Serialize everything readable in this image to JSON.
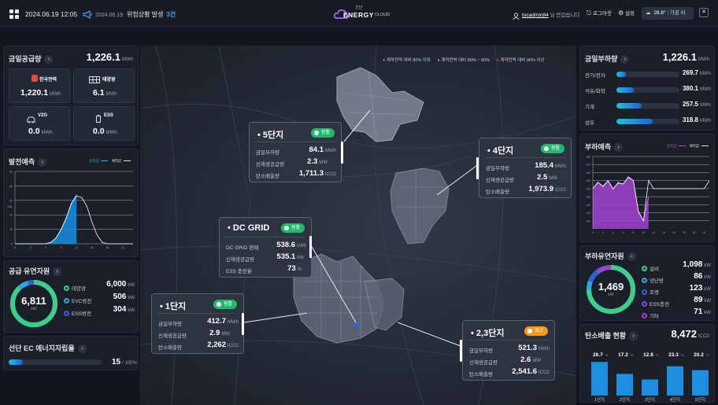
{
  "header": {
    "datetime": "2024.06.19 12:05",
    "alert_date": "2024.06.19",
    "alert_text": "위험상황 발생",
    "alert_count": "3건",
    "logo_top": "선단",
    "logo_main": "ENERGY",
    "logo_sub": "CLOUD",
    "user_name": "tocadmin84",
    "user_suffix": "님 반갑습니다",
    "logout": "로그아웃",
    "settings": "설정",
    "weather_temp": "28.8°",
    "weather_desc": "가끔 비",
    "close": "✕"
  },
  "supply": {
    "title": "금일공급량",
    "total": "1,226.1",
    "total_unit": "MWh",
    "cards": [
      {
        "label": "한국전력",
        "value": "1,220.1",
        "unit": "MWh",
        "icon": "utility-pole-icon"
      },
      {
        "label": "태양광",
        "value": "6.1",
        "unit": "MWh",
        "icon": "solar-panel-icon"
      },
      {
        "label": "V2G",
        "value": "0.0",
        "unit": "MWh",
        "icon": "ev-car-icon"
      },
      {
        "label": "ESS",
        "value": "0.0",
        "unit": "MWh",
        "icon": "battery-icon"
      }
    ]
  },
  "forecast": {
    "title": "발전예측",
    "legend_actual": "실측값",
    "legend_pred": "예측값",
    "chart_data": {
      "type": "area",
      "x": [
        0,
        1,
        2,
        3,
        4,
        5,
        6,
        7,
        8,
        9,
        10,
        11,
        12,
        13,
        14,
        15,
        16,
        17,
        18,
        19,
        20,
        21,
        22,
        23
      ],
      "series": [
        {
          "name": "실측값",
          "values": [
            0,
            0,
            0,
            0,
            0,
            0,
            0,
            1,
            4,
            10,
            18,
            28,
            34,
            null,
            null,
            null,
            null,
            null,
            null,
            null,
            null,
            null,
            null,
            null
          ]
        },
        {
          "name": "예측값",
          "values": [
            0,
            0,
            0,
            0,
            0,
            0,
            0,
            1,
            4,
            10,
            18,
            28,
            33,
            32,
            26,
            15,
            6,
            1,
            0,
            0,
            0,
            0,
            0,
            0
          ]
        }
      ],
      "ylim": [
        0,
        50
      ],
      "ytick_labels": [
        "0",
        "10",
        "20",
        "30",
        "40",
        "50"
      ],
      "xtick_labels": [
        "0",
        "3",
        "6",
        "9",
        "12",
        "15",
        "18",
        "21"
      ],
      "grid": true,
      "ylabel": "kW"
    }
  },
  "supply_resources": {
    "title": "공급 유연자원",
    "total": "6,811",
    "unit": "kW",
    "items": [
      {
        "label": "태양광",
        "value": "6,000",
        "unit": "kW",
        "color": "#3ad08a"
      },
      {
        "label": "EVC방전",
        "value": "506",
        "unit": "kW",
        "color": "#2aa9e0"
      },
      {
        "label": "ESS방전",
        "value": "304",
        "unit": "kW",
        "color": "#2f62d8"
      }
    ]
  },
  "self_rate": {
    "title": "선단 EC 에너지자립율",
    "value": "15",
    "unit": "/ 100%",
    "fraction": 0.15
  },
  "map": {
    "legend": [
      {
        "label": "계약전력 대비 80% 이하",
        "color": "#27c28a"
      },
      {
        "label": "계약전력 대비 80% ~ 90%",
        "color": "#f29a1a"
      },
      {
        "label": "계약전력 대비 90% 이상",
        "color": "#e0463c"
      }
    ],
    "label_row1": "금일부하량",
    "label_row2": "신재생공급량",
    "label_row3": "탄소배출량",
    "units": [
      "MWh",
      "MW",
      "tCO2"
    ],
    "sites": [
      {
        "name": "5단지",
        "status": "원활",
        "v1": "84.1",
        "v2": "2.3",
        "v3": "1,711.3"
      },
      {
        "name": "4단지",
        "status": "원활",
        "v1": "185.4",
        "v2": "2.5",
        "v3": "1,973.9"
      },
      {
        "name": "1단지",
        "status": "원활",
        "v1": "412.7",
        "v2": "2.9",
        "v3": "2,262"
      },
      {
        "name": "2,3단지",
        "status": "경고",
        "v1": "521.3",
        "v2": "2.6",
        "v3": "2,541.6"
      }
    ],
    "dcgrid": {
      "name": "DC GRID",
      "status": "원활",
      "row1": "DC GRID 판매",
      "v1": "538.6",
      "u1": "kWh",
      "row2": "신재생공급량",
      "v2": "535.1",
      "u2": "kW",
      "row3": "ESS 충전율",
      "v3": "73",
      "u3": "%"
    }
  },
  "load": {
    "title": "금일부하량",
    "total": "1,226.1",
    "unit": "MWh",
    "items": [
      {
        "label": "전기/전자",
        "value": "269.7",
        "unit": "MWh",
        "fraction": 0.15
      },
      {
        "label": "석유/화학",
        "value": "380.1",
        "unit": "MWh",
        "fraction": 0.28
      },
      {
        "label": "기계",
        "value": "257.5",
        "unit": "MWh",
        "fraction": 0.4
      },
      {
        "label": "섬유",
        "value": "318.8",
        "unit": "MWh",
        "fraction": 0.57
      }
    ]
  },
  "load_forecast": {
    "title": "부하예측",
    "legend_actual": "실측값",
    "legend_pred": "예측값",
    "chart_data": {
      "type": "area",
      "x": [
        0,
        1,
        2,
        3,
        4,
        5,
        6,
        7,
        8,
        9,
        10,
        11,
        12,
        13,
        14,
        15,
        16,
        17,
        18,
        19,
        20,
        21,
        22,
        23
      ],
      "series": [
        {
          "name": "실측값",
          "values": [
            140,
            148,
            142,
            150,
            139,
            148,
            145,
            155,
            150,
            110,
            100,
            130,
            null,
            null,
            null,
            null,
            null,
            null,
            null,
            null,
            null,
            null,
            null,
            null
          ]
        },
        {
          "name": "예측값",
          "values": [
            140,
            148,
            143,
            150,
            140,
            147,
            146,
            154,
            150,
            112,
            100,
            150,
            140,
            140,
            140,
            140,
            140,
            140,
            140,
            140,
            140,
            140,
            140,
            150
          ]
        }
      ],
      "ylim": [
        90,
        180
      ],
      "ytick_labels": [
        "100",
        "110",
        "120",
        "130",
        "140",
        "150",
        "160",
        "170",
        "180"
      ],
      "xtick_labels": [
        "0",
        "2",
        "4",
        "6",
        "8",
        "10",
        "12",
        "14",
        "16",
        "18",
        "20",
        "22"
      ],
      "grid": true
    }
  },
  "load_resources": {
    "title": "부하유연자원",
    "total": "1,469",
    "unit": "kW",
    "items": [
      {
        "label": "설비",
        "value": "1,098",
        "unit": "kW",
        "color": "#3ad08a"
      },
      {
        "label": "냉난방",
        "value": "86",
        "unit": "kW",
        "color": "#2aa9e0"
      },
      {
        "label": "조명",
        "value": "123",
        "unit": "kW",
        "color": "#2f62d8"
      },
      {
        "label": "ESS충전",
        "value": "89",
        "unit": "kW",
        "color": "#7b52d6"
      },
      {
        "label": "기타",
        "value": "71",
        "unit": "kW",
        "color": "#a53fc9"
      }
    ]
  },
  "carbon": {
    "title": "탄소배출 현황",
    "total": "8,472",
    "unit": "tCO2",
    "chart_data": {
      "type": "bar",
      "categories": [
        "1단지",
        "2단지",
        "3단지",
        "4단지",
        "5단지"
      ],
      "values": [
        26.7,
        17.2,
        12.8,
        23.3,
        20.2
      ],
      "labels": [
        "26.7",
        "17.2",
        "12.8",
        "23.3",
        "20.2"
      ],
      "unit": "%"
    }
  }
}
